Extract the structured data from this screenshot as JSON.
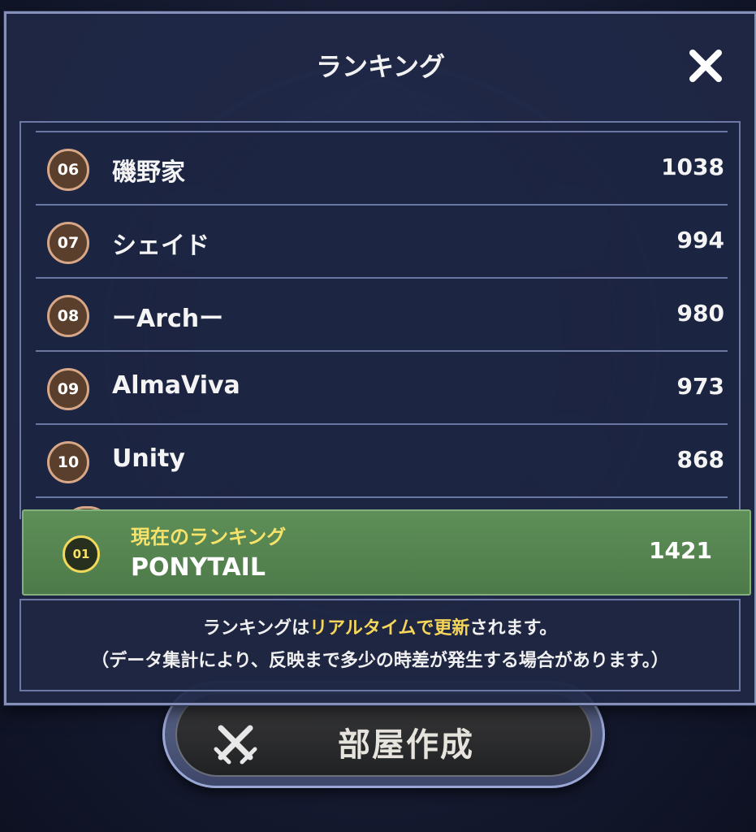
{
  "dialog": {
    "title": "ランキング",
    "close_icon": "close-icon"
  },
  "rankings": [
    {
      "rank": "06",
      "name": "磯野家",
      "score": "1038"
    },
    {
      "rank": "07",
      "name": "シェイド",
      "score": "994"
    },
    {
      "rank": "08",
      "name": "ーArchー",
      "score": "980"
    },
    {
      "rank": "09",
      "name": "AlmaViva",
      "score": "973"
    },
    {
      "rank": "10",
      "name": "Unity",
      "score": "868"
    }
  ],
  "current_ranking": {
    "label": "現在のランキング",
    "rank": "01",
    "name": "PONYTAIL",
    "score": "1421"
  },
  "notice": {
    "line1_prefix": "ランキングは",
    "line1_highlight": "リアルタイムで更新",
    "line1_suffix": "されます。",
    "line2": "（データ集計により、反映まで多少の時差が発生する場合があります。）"
  },
  "create_room_button": {
    "label": "部屋作成",
    "icon": "crossed-swords-icon"
  },
  "colors": {
    "highlight_yellow": "#f6d65a",
    "current_row_green": "#5e8f58",
    "badge_brown": "#5a3f2c",
    "panel_border": "#8490b8"
  }
}
